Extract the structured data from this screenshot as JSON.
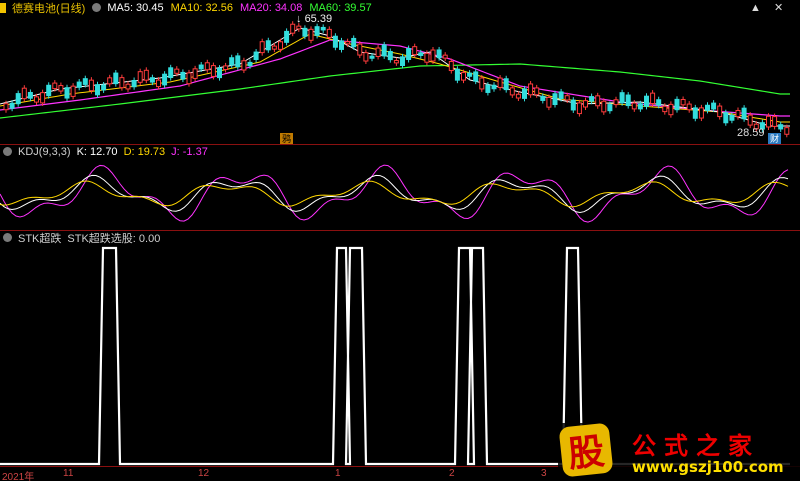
{
  "main_panel": {
    "stock_name": "德赛电池(日线)",
    "indicators": [
      {
        "label": "MA5: 30.45",
        "color": "#ffffff"
      },
      {
        "label": "MA10: 32.56",
        "color": "#ffd700"
      },
      {
        "label": "MA20: 34.08",
        "color": "#ff33ff"
      },
      {
        "label": "MA60: 39.57",
        "color": "#33ff33"
      }
    ],
    "high_label": "65.39",
    "low_label": "28.59",
    "marker_left": "鸦",
    "marker_right": "财"
  },
  "kdj_panel": {
    "title": "KDJ(9,3,3)",
    "k": "K: 12.70",
    "d": "D: 19.73",
    "j": "J: -1.37"
  },
  "stk_panel": {
    "title": "STK超跌",
    "line": "STK超跌选股: 0.00"
  },
  "x_axis": [
    "2021年",
    "11",
    "12",
    "1",
    "2",
    "3"
  ],
  "watermark": {
    "badge": "股",
    "title": "公式之家",
    "url": "www.gszj100.com"
  },
  "colors": {
    "background": "#000000",
    "separator": "#8a1010",
    "up": "#ff3c3c",
    "down": "#33dddd",
    "ma5": "#ffffff",
    "ma10": "#ffd700",
    "ma20": "#ff33ff",
    "ma60": "#33ff33"
  }
}
